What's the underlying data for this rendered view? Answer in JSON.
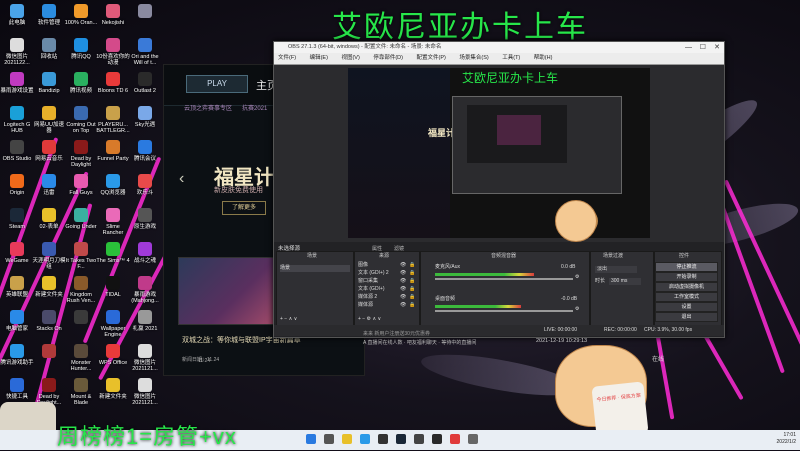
{
  "overlay": {
    "top_title": "艾欧尼亚办卡上车",
    "bottom_text": "周榜榜1=房管+vx"
  },
  "desktop_icons": [
    {
      "label": "此电脑",
      "color": "#4aa3e8"
    },
    {
      "label": "软件管理",
      "color": "#2b8de0"
    },
    {
      "label": "100% Oran...",
      "color": "#f09a2a"
    },
    {
      "label": "Nekojishi",
      "color": "#e05a7a"
    },
    {
      "label": "",
      "color": "#8a8aa0"
    },
    {
      "label": "微信图片 2021122...",
      "color": "#ddd"
    },
    {
      "label": "回收站",
      "color": "#6a8aa8"
    },
    {
      "label": "腾讯QQ",
      "color": "#1e8fe0"
    },
    {
      "label": "10份喜欢你的动漫",
      "color": "#d44a8a"
    },
    {
      "label": "Ori and the Will of t...",
      "color": "#3a7ad8"
    },
    {
      "label": "暴雨游戏设置",
      "color": "#c03ac0"
    },
    {
      "label": "Bandizip",
      "color": "#3a9ad8"
    },
    {
      "label": "腾讯视频",
      "color": "#2ab060"
    },
    {
      "label": "Bloons TD 6",
      "color": "#e83a3a"
    },
    {
      "label": "Outlast 2",
      "color": "#2a2a2a"
    },
    {
      "label": "Logitech G HUB",
      "color": "#1aa0d8"
    },
    {
      "label": "网易UU加速器",
      "color": "#e8b02a"
    },
    {
      "label": "Coming Out on Top",
      "color": "#3a6ab0"
    },
    {
      "label": "PLAYERU... BATTLEGR...",
      "color": "#c9a14a"
    },
    {
      "label": "Sky光遇",
      "color": "#7aa8e8"
    },
    {
      "label": "OBS Studio",
      "color": "#444"
    },
    {
      "label": "网易云音乐",
      "color": "#e03a3a"
    },
    {
      "label": "Dead by Daylight",
      "color": "#8a1a1a"
    },
    {
      "label": "Funnel Party",
      "color": "#d87a2a"
    },
    {
      "label": "腾讯会议",
      "color": "#2a7ae0"
    },
    {
      "label": "Origin",
      "color": "#f06a1a"
    },
    {
      "label": "迅雷",
      "color": "#2a8ae8"
    },
    {
      "label": "Fall Guys",
      "color": "#e85ab0"
    },
    {
      "label": "QQ浏览器",
      "color": "#2a9ae8"
    },
    {
      "label": "欢乐斗",
      "color": "#e84a4a"
    },
    {
      "label": "Steam",
      "color": "#1b2838"
    },
    {
      "label": "02-表单",
      "color": "#e8c02a"
    },
    {
      "label": "Going Under",
      "color": "#3ab0a0"
    },
    {
      "label": "Slime Rancher",
      "color": "#ea6ab8"
    },
    {
      "label": "原生游戏",
      "color": "#555"
    },
    {
      "label": "WeGame",
      "color": "#e83a5a"
    },
    {
      "label": "天涯明月刀模组",
      "color": "#3a5ab0"
    },
    {
      "label": "It Takes Two F...",
      "color": "#c04a4a"
    },
    {
      "label": "The Sims™ 4",
      "color": "#2ac03a"
    },
    {
      "label": "战斗之魂",
      "color": "#a03ad8"
    },
    {
      "label": "英雄联盟",
      "color": "#c9a14a"
    },
    {
      "label": "新建文件夹",
      "color": "#e8c02a"
    },
    {
      "label": "Kingdom Rush Ven...",
      "color": "#8a5a2a"
    },
    {
      "label": "TIDAL",
      "color": "#111"
    },
    {
      "label": "暴雨游戏 (Mahjong...",
      "color": "#c03a8a"
    },
    {
      "label": "电脑管家",
      "color": "#2a8ae8"
    },
    {
      "label": "Stacks On",
      "color": "#4a4a6a"
    },
    {
      "label": "",
      "color": "#3a3a3a"
    },
    {
      "label": "Wallpaper Engine",
      "color": "#2a6ad8"
    },
    {
      "label": "礼赢 2021",
      "color": "#999"
    },
    {
      "label": "腾讯游戏助手",
      "color": "#2a9ae8"
    },
    {
      "label": "",
      "color": "#b03a3a"
    },
    {
      "label": "Monster Hunter...",
      "color": "#5a4a3a"
    },
    {
      "label": "WPS Office",
      "color": "#e83a3a"
    },
    {
      "label": "微信图片 2021121...",
      "color": "#ddd"
    },
    {
      "label": "快捷工具",
      "color": "#2a6ad8"
    },
    {
      "label": "Dead by Daylight...",
      "color": "#8a1a1a"
    },
    {
      "label": "Mount & Blade",
      "color": "#6a5a3a"
    },
    {
      "label": "新建文件夹",
      "color": "#e8c02a"
    },
    {
      "label": "微信图片 2021121...",
      "color": "#ddd"
    }
  ],
  "launcher": {
    "play_label": "PLAY",
    "home_label": "主页",
    "nav": [
      "云顶之弈",
      "赛事专区",
      "抗赛2021"
    ],
    "promo_title": "福星计划",
    "promo_sub": "新皮肤免费使用",
    "promo_button": "了解更多",
    "news_text": "双城之战：等你城与联盟IP宇宙新篇章",
    "news_time": "新闻日期：11.24",
    "news_btn": "查看"
  },
  "obs": {
    "title": "OBS 27.1.3 (64-bit, windows)  - 配置文件: 未命名 - 场景: 未命名",
    "menu": [
      "文件(F)",
      "编辑(E)",
      "视图(V)",
      "停靠部件(D)",
      "配置文件(P)",
      "场景集合(S)",
      "工具(T)",
      "帮助(H)"
    ],
    "scene_selector": "未选择源",
    "scene_props_buttons": [
      "属性",
      "滤镜"
    ],
    "panel_headers": {
      "scenes": "场景",
      "sources": "来源",
      "mixer": "音频混音器",
      "transitions": "场景过渡",
      "controls": "控件"
    },
    "scenes": [
      "场景"
    ],
    "sources": [
      {
        "name": "图像"
      },
      {
        "name": "文本 (GDI+) 2"
      },
      {
        "name": "窗口采集"
      },
      {
        "name": "文本 (GDI+)"
      },
      {
        "name": "媒体源 2"
      },
      {
        "name": "媒体源"
      }
    ],
    "mixer": [
      {
        "name": "麦克风/Aux",
        "db": "0.0 dB",
        "level": 0.72
      },
      {
        "name": "桌面音频",
        "db": "-0.0 dB",
        "level": 0.62
      }
    ],
    "transitions": {
      "type": "淡出",
      "duration_label": "时长",
      "duration_value": "300 ms"
    },
    "controls": [
      "停止推流",
      "开始录制",
      "启动虚拟摄像机",
      "工作室模式",
      "设置",
      "退出"
    ],
    "status": {
      "live": "LIVE: 00:00:00",
      "rec": "REC: 00:00:00",
      "cpu": "CPU: 3.9%, 30.00 fps"
    }
  },
  "overlays": {
    "chat_line": "2021-12-19 10:29:13",
    "chat_msg": "A 直播间在线人数 · 吧友福利聊天 · 等待中的直播间",
    "chat_tip": "来来  新用户注册送30元优惠券",
    "left_time": "11:24",
    "chip": "在线"
  },
  "stamp_text": "今日推荐 · 保底方案",
  "taskbar": {
    "time": "17:01",
    "date": "2022/1/2"
  }
}
